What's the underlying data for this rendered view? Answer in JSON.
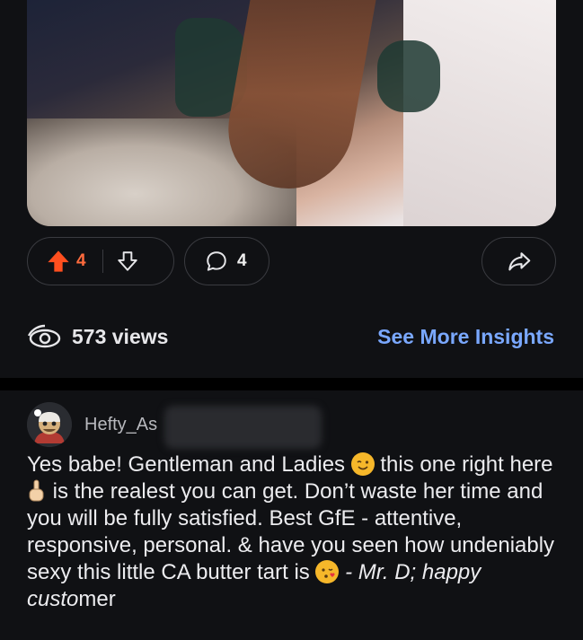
{
  "post": {
    "upvotes": "4",
    "comments": "4",
    "views": "573 views",
    "insights_link": "See More Insights"
  },
  "comment": {
    "username": "Hefty_As",
    "text_1": "Yes babe! Gentleman and Ladies",
    "text_2": " this one right here",
    "text_3": " is the realest you can get. Don’t waste her time and you will be fully satisfied. Best GfE - attentive, responsive, personal. & have you seen how undeniably sexy this little CA butter tart is",
    "signature": " - Mr. D; happy custo",
    "signature_tail": "mer"
  },
  "icons": [
    "upvote-icon",
    "downvote-icon",
    "comment-icon",
    "share-icon",
    "views-icon",
    "wink-emoji-icon",
    "pointing-up-emoji-icon",
    "kiss-emoji-icon"
  ],
  "colors": {
    "upvote": "#ff6b3d",
    "link": "#7aa8ff",
    "background": "#101114"
  }
}
